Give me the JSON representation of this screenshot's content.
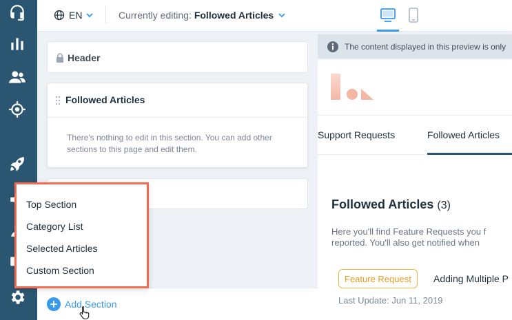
{
  "top_bar": {
    "language": "EN",
    "editing_prefix": "Currently editing:",
    "editing_page": "Followed Articles"
  },
  "sections_panel": {
    "header_card_title": "Header",
    "followed_card_title": "Followed Articles",
    "followed_card_note": "There's nothing to edit in this section. You can add other sections to this page and edit them.",
    "add_section_label": "Add Section"
  },
  "add_section_menu": {
    "items": [
      {
        "label": "Top Section"
      },
      {
        "label": "Category List"
      },
      {
        "label": "Selected Articles"
      },
      {
        "label": "Custom Section"
      }
    ]
  },
  "preview": {
    "info_text": "The content displayed in this preview is only",
    "tabs": [
      {
        "label": "Support Requests",
        "active": false
      },
      {
        "label": "Followed Articles",
        "active": true
      }
    ],
    "heading": "Followed Articles",
    "heading_count": "(3)",
    "description_line1": "Here you'll find Feature Requests you f",
    "description_line2": "reported. You'll also get notified when",
    "article_badge": "Feature Request",
    "article_title": "Adding Multiple P",
    "article_updated": "Last Update: Jun 11, 2019"
  },
  "colors": {
    "rail": "#2b5672",
    "accent": "#3899ec",
    "highlight": "#f26b52",
    "badge": "#f0b43c"
  },
  "rail_icons": [
    "headset-icon",
    "bar-chart-icon",
    "users-icon",
    "target-icon",
    "rocket-icon",
    "megaphone-icon",
    "person-icon",
    "monitor-icon",
    "gear-icon"
  ]
}
